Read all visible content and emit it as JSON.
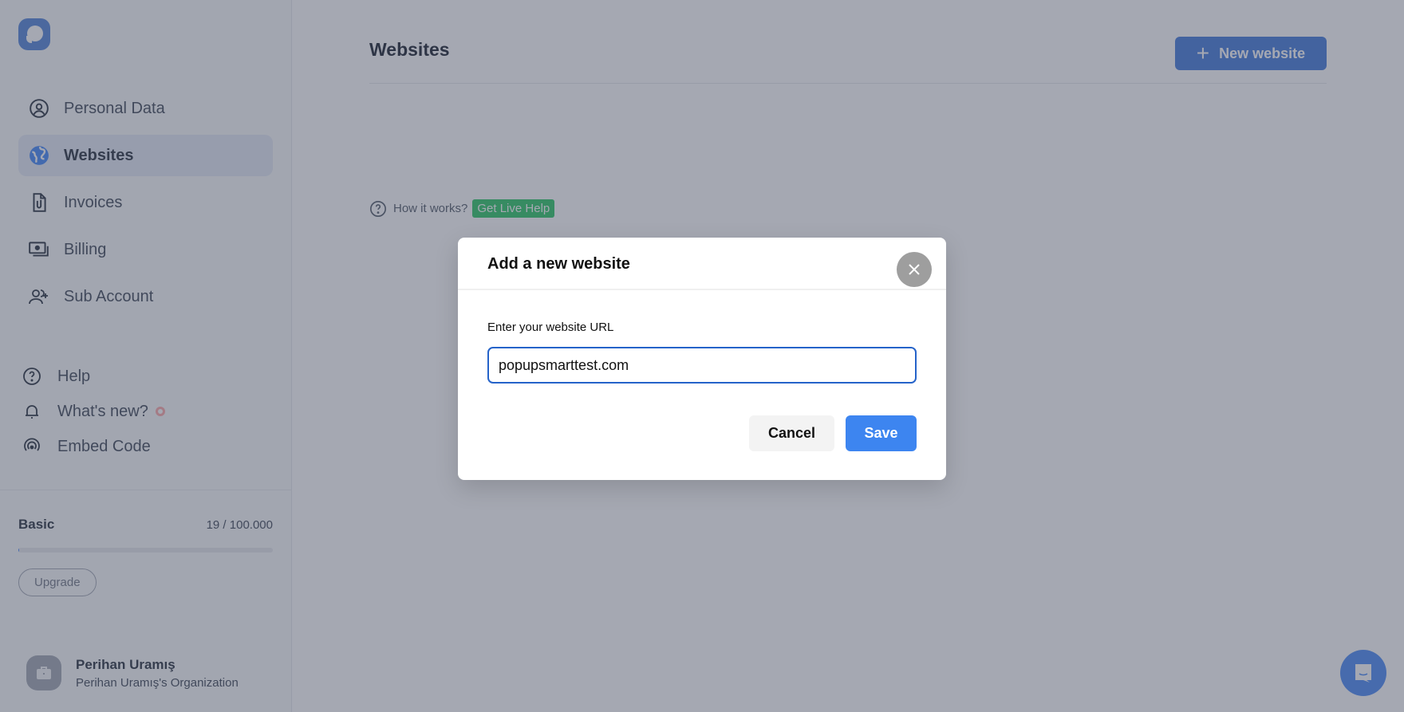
{
  "sidebar": {
    "logo": "popupsmart-logo",
    "nav": [
      {
        "label": "Personal Data",
        "icon": "user-circle-icon",
        "active": false
      },
      {
        "label": "Websites",
        "icon": "globe-icon",
        "active": true
      },
      {
        "label": "Invoices",
        "icon": "document-clip-icon",
        "active": false
      },
      {
        "label": "Billing",
        "icon": "cash-icon",
        "active": false
      },
      {
        "label": "Sub Account",
        "icon": "user-add-icon",
        "active": false
      }
    ],
    "secondary": [
      {
        "label": "Help",
        "icon": "question-circle-icon"
      },
      {
        "label": "What's new?",
        "icon": "bell-icon",
        "badge": true
      },
      {
        "label": "Embed Code",
        "icon": "broadcast-icon"
      }
    ],
    "plan": {
      "name": "Basic",
      "usage_text": "19 / 100.000",
      "used": 19,
      "limit": 100000,
      "upgrade_label": "Upgrade"
    },
    "user": {
      "name": "Perihan Uramış",
      "organization": "Perihan Uramış's Organization"
    }
  },
  "main": {
    "title": "Websites",
    "new_website_label": "New website",
    "how_it_works": "How it works?",
    "live_help": "Get Live Help"
  },
  "modal": {
    "title": "Add a new website",
    "field_label": "Enter your website URL",
    "url_value": "popupsmarttest.com",
    "cancel_label": "Cancel",
    "save_label": "Save"
  },
  "colors": {
    "accent": "#3b82f6",
    "save": "#3d85f0",
    "live_help": "#22c55e",
    "badge": "#fca5a5"
  }
}
